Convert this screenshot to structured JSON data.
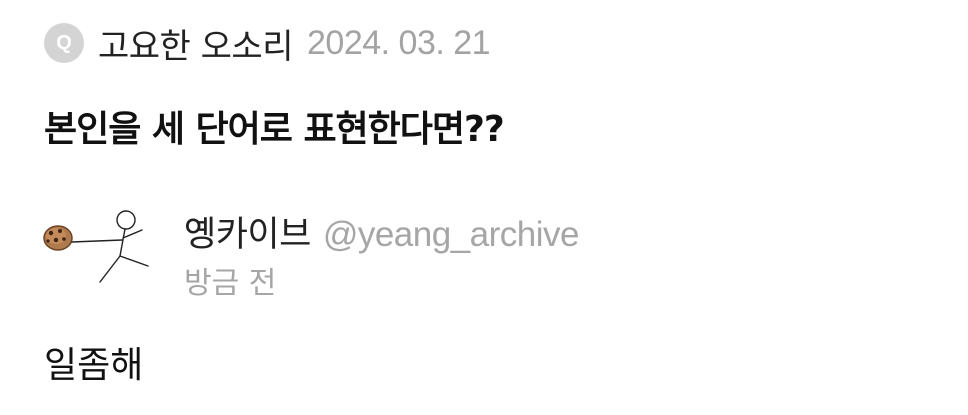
{
  "question": {
    "badge": "Q",
    "asker": "고요한 오소리",
    "date": "2024. 03. 21",
    "text": "본인을 세 단어로 표현한다면??"
  },
  "answer": {
    "author_name": "옝카이브",
    "author_handle": "@yeang_archive",
    "time": "방금 전",
    "text": "일좀해"
  },
  "colors": {
    "badge_bg": "#d4d4d4",
    "meta_gray": "#a6a6a6",
    "text_dark": "#111111"
  }
}
